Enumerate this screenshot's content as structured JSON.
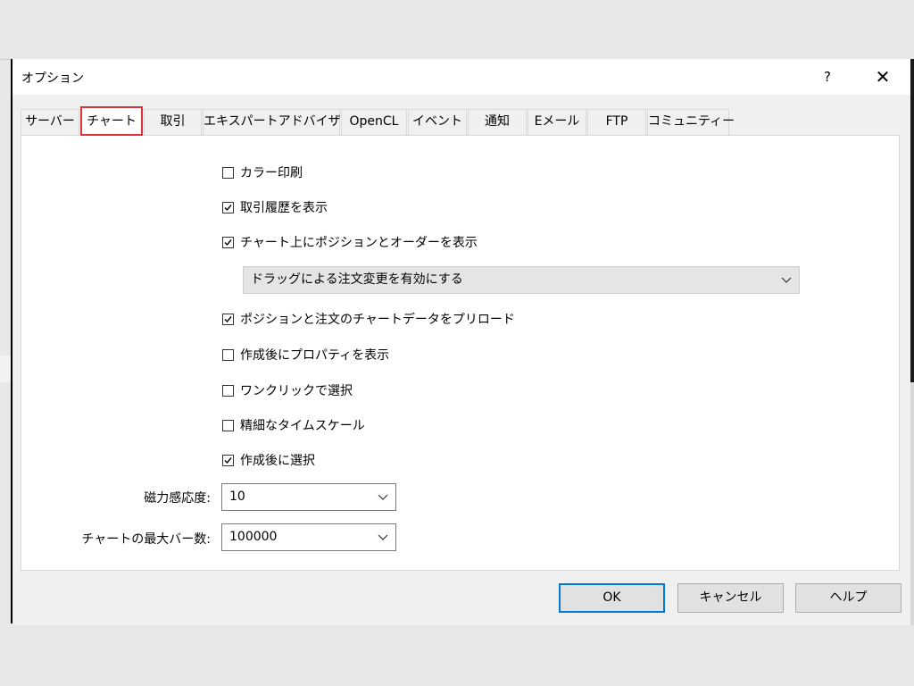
{
  "dialog": {
    "title": "オプション",
    "help_label": "?",
    "close_label": "✕"
  },
  "tabs": [
    {
      "label": "サーバー"
    },
    {
      "label": "チャート"
    },
    {
      "label": "取引"
    },
    {
      "label": "エキスパートアドバイザ"
    },
    {
      "label": "OpenCL"
    },
    {
      "label": "イベント"
    },
    {
      "label": "通知"
    },
    {
      "label": "Eメール"
    },
    {
      "label": "FTP"
    },
    {
      "label": "コミュニティー"
    }
  ],
  "options": {
    "color_print": {
      "label": "カラー印刷",
      "checked": false
    },
    "show_trade_history": {
      "label": "取引履歴を表示",
      "checked": true
    },
    "show_positions_orders": {
      "label": "チャート上にポジションとオーダーを表示",
      "checked": true
    },
    "drag_mode": {
      "value": "ドラッグによる注文変更を有効にする"
    },
    "preload_chart_data": {
      "label": "ポジションと注文のチャートデータをプリロード",
      "checked": true
    },
    "show_properties": {
      "label": "作成後にプロパティを表示",
      "checked": false
    },
    "one_click_select": {
      "label": "ワンクリックで選択",
      "checked": false
    },
    "fine_timescale": {
      "label": "精細なタイムスケール",
      "checked": false
    },
    "select_after_create": {
      "label": "作成後に選択",
      "checked": true
    }
  },
  "magnet": {
    "label": "磁力感応度:",
    "value": "10"
  },
  "max_bars": {
    "label": "チャートの最大バー数:",
    "value": "100000"
  },
  "buttons": {
    "ok": "OK",
    "cancel": "キャンセル",
    "help": "ヘルプ"
  }
}
